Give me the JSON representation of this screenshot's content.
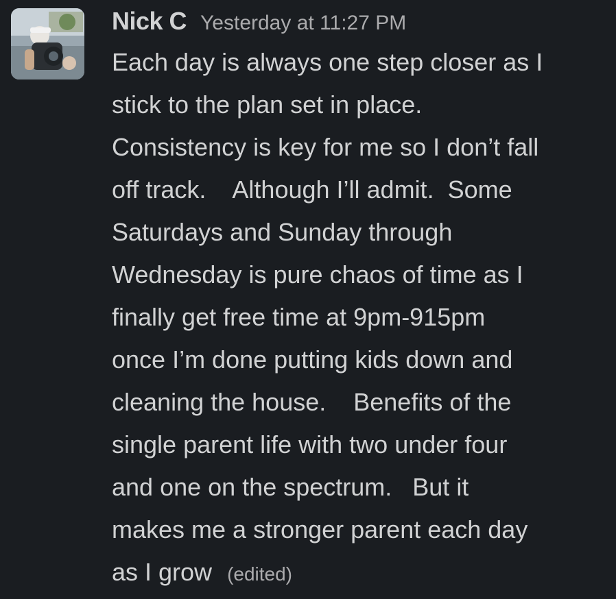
{
  "message": {
    "sender": "Nick C",
    "timestamp": "Yesterday at 11:27 PM",
    "lines": [
      "Each day is always one step closer as I",
      "stick to the plan set in place.",
      "Consistency is key for me so I don’t fall",
      "off track.    Although I’ll admit.  Some",
      "Saturdays and Sunday through",
      "Wednesday is pure chaos of time as I",
      "finally get free time at 9pm-915pm",
      "once I’m done putting kids down and",
      "cleaning the house.    Benefits of the",
      "single parent life with two under four",
      "and one on the spectrum.   But it",
      "makes me a stronger parent each day",
      "as I grow"
    ],
    "edited_label": "(edited)"
  },
  "colors": {
    "background": "#1a1d21",
    "text": "#d1d2d3",
    "muted": "#ababad"
  }
}
